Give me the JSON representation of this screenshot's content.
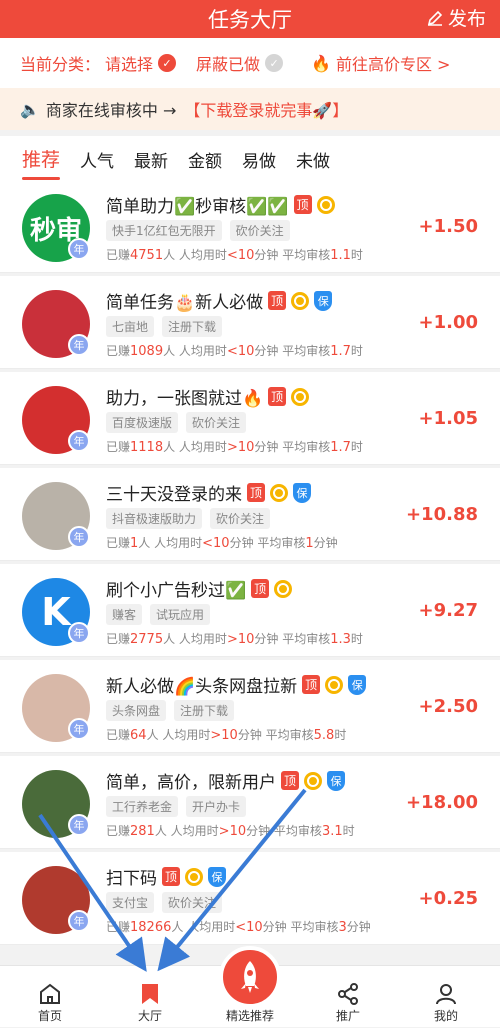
{
  "header": {
    "title": "任务大厅",
    "publish": "发布"
  },
  "filter": {
    "category_label": "当前分类：",
    "category_value": "请选择",
    "hide_done": "屏蔽已做",
    "premium": "前往高价专区 >"
  },
  "notice": {
    "text": "商家在线审核中 →",
    "link": "【下载登录就完事🚀】"
  },
  "tabs": [
    "推荐",
    "人气",
    "最新",
    "金额",
    "易做",
    "未做"
  ],
  "tasks": [
    {
      "title": "简单助力✅秒审核✅✅",
      "ding": "顶",
      "bao": false,
      "tags": [
        "快手1亿红包无限开",
        "砍价关注"
      ],
      "done": "4751",
      "avg_time": "<10",
      "review": "1.1",
      "price": "+1.50",
      "avatar_text": "秒审",
      "avatar_color": "#17a34a"
    },
    {
      "title": "简单任务🎂新人必做",
      "ding": "顶",
      "bao": true,
      "tags": [
        "七亩地",
        "注册下载"
      ],
      "done": "1089",
      "avg_time": "<10",
      "review": "1.7",
      "price": "+1.00",
      "avatar_text": "",
      "avatar_color": "#c9303a"
    },
    {
      "title": "助力，一张图就过🔥",
      "ding": "顶",
      "bao": false,
      "tags": [
        "百度极速版",
        "砍价关注"
      ],
      "done": "1118",
      "avg_time": ">10",
      "review": "1.7",
      "price": "+1.05",
      "avatar_text": "",
      "avatar_color": "#d32f2f"
    },
    {
      "title": "三十天没登录的来",
      "ding": "顶",
      "bao": true,
      "tags": [
        "抖音极速版助力",
        "砍价关注"
      ],
      "done": "1",
      "avg_time": "<10",
      "review": "1",
      "review_unit": "分钟",
      "price": "+10.88",
      "avatar_text": "",
      "avatar_color": "#b9b2a8"
    },
    {
      "title": "刷个小广告秒过✅",
      "ding": "顶",
      "bao": false,
      "tags": [
        "赚客",
        "试玩应用"
      ],
      "done": "2775",
      "avg_time": ">10",
      "review": "1.3",
      "price": "+9.27",
      "avatar_text": "K",
      "avatar_color": "#1e88e5"
    },
    {
      "title": "新人必做🌈头条网盘拉新",
      "ding": "顶",
      "bao": true,
      "tags": [
        "头条网盘",
        "注册下载"
      ],
      "done": "64",
      "avg_time": ">10",
      "review": "5.8",
      "price": "+2.50",
      "avatar_text": "",
      "avatar_color": "#d8b8a8"
    },
    {
      "title": "简单，高价，限新用户",
      "ding": "顶",
      "bao": true,
      "tags": [
        "工行养老金",
        "开户办卡"
      ],
      "done": "281",
      "avg_time": ">10",
      "review": "3.1",
      "price": "+18.00",
      "avatar_text": "",
      "avatar_color": "#4a6b3a"
    },
    {
      "title": "扫下码",
      "ding": "顶",
      "bao": true,
      "tags": [
        "支付宝",
        "砍价关注"
      ],
      "done": "18266",
      "avg_time": "<10",
      "review": "3",
      "review_unit": "分钟",
      "price": "+0.25",
      "avatar_text": "",
      "avatar_color": "#b03a2e"
    }
  ],
  "stats_labels": {
    "done_prefix": "已赚",
    "done_suffix": "人 人均用时",
    "time_unit": "分钟 平均审核",
    "review_unit": "时"
  },
  "nav": [
    {
      "label": "首页",
      "icon": "home-icon"
    },
    {
      "label": "大厅",
      "icon": "bookmark-icon"
    },
    {
      "label": "精选推荐",
      "icon": "rocket-icon"
    },
    {
      "label": "推广",
      "icon": "share-icon"
    },
    {
      "label": "我的",
      "icon": "user-icon"
    }
  ],
  "colors": {
    "accent": "#ee4a3b",
    "blue": "#2b8ff0",
    "coin": "#f7b500"
  }
}
